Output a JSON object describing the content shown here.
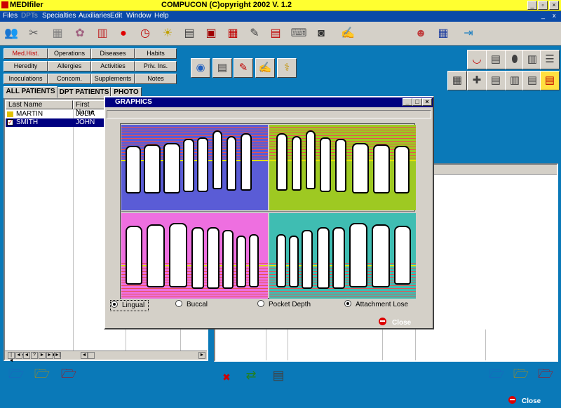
{
  "window": {
    "app_title": "MEDIfiler",
    "copyright": "COMPUCON (C)opyright 2002  V. 1.2",
    "minimize": "_",
    "restore": "▫",
    "close": "×"
  },
  "menu": [
    "Files",
    "DPTs",
    "Specialties",
    "Auxiliaries",
    "Edit",
    "Window",
    "Help"
  ],
  "toolbar_icons": [
    "people-icon",
    "scissors-icon",
    "abacus-icon",
    "brain-icon",
    "books-icon",
    "apple-icon",
    "clock-icon",
    "lightbulb-icon",
    "calendar-clock-icon",
    "film-icon",
    "calendar-17-icon",
    "notes-icon",
    "prescription-icon",
    "keyboard-icon",
    "xray-icon",
    "camera-icon",
    "edit-document-icon",
    "doctor-icon",
    "calculator-icon",
    "exit-icon"
  ],
  "categories": [
    {
      "label": "Med.Hist.",
      "active": true
    },
    {
      "label": "Operations"
    },
    {
      "label": "Diseases"
    },
    {
      "label": "Habits"
    },
    {
      "label": "Heredity"
    },
    {
      "label": "Allergies"
    },
    {
      "label": "Activities"
    },
    {
      "label": "Priv. Ins."
    },
    {
      "label": "Inoculations"
    },
    {
      "label": "Concom."
    },
    {
      "label": "Supplements"
    },
    {
      "label": "Notes"
    }
  ],
  "tabs": [
    "ALL PATIENTS",
    "DPT PATIENTS",
    "PHOTO"
  ],
  "patients": {
    "columns": [
      "Last Name",
      "First Name"
    ],
    "rows": [
      {
        "last": "MARTIN",
        "first": "JULIA",
        "selected": false
      },
      {
        "last": "SMITH",
        "first": "JOHN",
        "selected": true
      }
    ]
  },
  "nav_buttons": [
    "|◄",
    "◄◄",
    "◄",
    "?",
    "►",
    "►►",
    "►|"
  ],
  "dialog": {
    "title": "GRAPHICS",
    "options": [
      {
        "label": "Lingual",
        "checked": true
      },
      {
        "label": "Buccal",
        "checked": false
      },
      {
        "label": "Pocket Depth",
        "checked": false
      },
      {
        "label": "Attachment Lose",
        "checked": true
      }
    ],
    "close_label": "Close"
  },
  "main_close_label": "Close",
  "colors": {
    "background": "#0a79b8",
    "title_bar": "#ffff30",
    "quad_upper_right": "#9ec922",
    "quad_upper_left": "#5a5cd6",
    "quad_lower_left": "#ee6fe0",
    "quad_lower_right": "#3fbdb2"
  }
}
